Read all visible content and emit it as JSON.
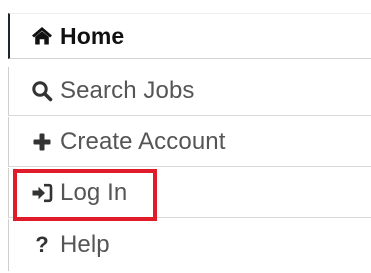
{
  "nav": {
    "items": [
      {
        "label": "Home",
        "icon": "home-icon",
        "active": true
      },
      {
        "label": "Search Jobs",
        "icon": "search-icon"
      },
      {
        "label": "Create Account",
        "icon": "plus-icon"
      },
      {
        "label": "Log In",
        "icon": "sign-in-icon",
        "highlighted": true
      },
      {
        "label": "Help",
        "icon": "question-icon"
      }
    ]
  },
  "colors": {
    "highlight": "#e11c2a",
    "active_border": "#1f2530",
    "text": "#555555"
  }
}
